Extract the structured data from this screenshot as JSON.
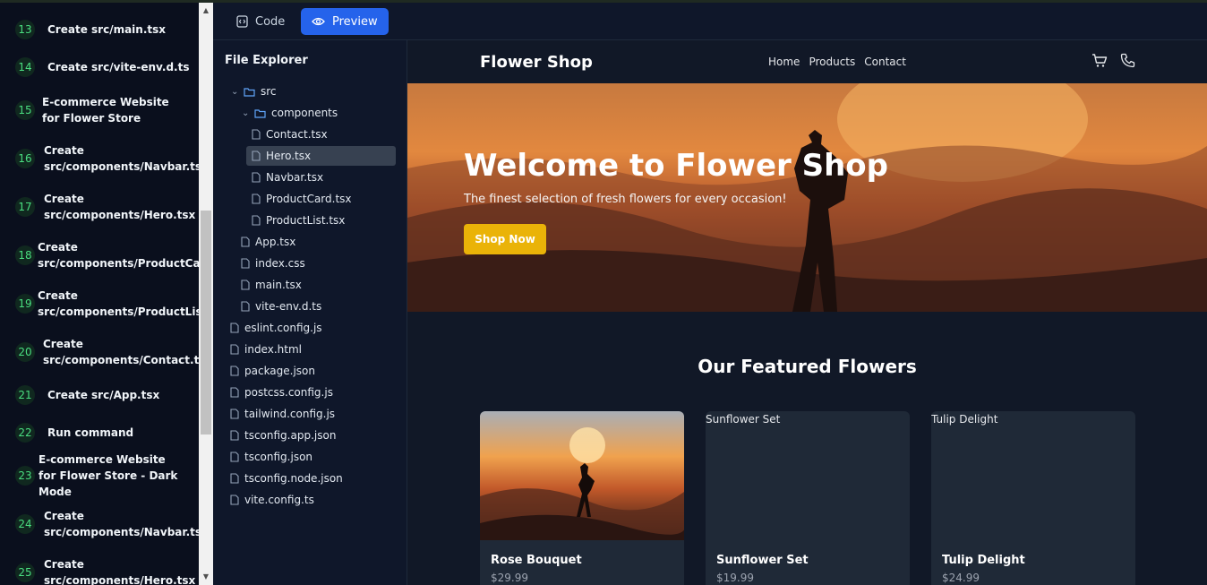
{
  "steps": [
    {
      "num": "13",
      "title": "Create src/main.tsx"
    },
    {
      "num": "14",
      "title": "Create src/vite-env.d.ts"
    },
    {
      "num": "15",
      "title": "E-commerce Website for Flower Store"
    },
    {
      "num": "16",
      "title": "Create src/components/Navbar.tsx"
    },
    {
      "num": "17",
      "title": "Create src/components/Hero.tsx"
    },
    {
      "num": "18",
      "title": "Create src/components/ProductCard.tsx"
    },
    {
      "num": "19",
      "title": "Create src/components/ProductList.tsx"
    },
    {
      "num": "20",
      "title": "Create src/components/Contact.tsx"
    },
    {
      "num": "21",
      "title": "Create src/App.tsx"
    },
    {
      "num": "22",
      "title": "Run command"
    },
    {
      "num": "23",
      "title": "E-commerce Website for Flower Store - Dark Mode"
    },
    {
      "num": "24",
      "title": "Create src/components/Navbar.tsx"
    },
    {
      "num": "25",
      "title": "Create src/components/Hero.tsx"
    }
  ],
  "toolbar": {
    "code_label": "Code",
    "preview_label": "Preview"
  },
  "explorer": {
    "title": "File Explorer",
    "items": [
      {
        "name": "src",
        "type": "folder",
        "open": true
      },
      {
        "name": "components",
        "type": "folder",
        "open": true
      },
      {
        "name": "Contact.tsx",
        "type": "file"
      },
      {
        "name": "Hero.tsx",
        "type": "file",
        "selected": true
      },
      {
        "name": "Navbar.tsx",
        "type": "file"
      },
      {
        "name": "ProductCard.tsx",
        "type": "file"
      },
      {
        "name": "ProductList.tsx",
        "type": "file"
      },
      {
        "name": "App.tsx",
        "type": "file"
      },
      {
        "name": "index.css",
        "type": "file"
      },
      {
        "name": "main.tsx",
        "type": "file"
      },
      {
        "name": "vite-env.d.ts",
        "type": "file"
      },
      {
        "name": "eslint.config.js",
        "type": "file"
      },
      {
        "name": "index.html",
        "type": "file"
      },
      {
        "name": "package.json",
        "type": "file"
      },
      {
        "name": "postcss.config.js",
        "type": "file"
      },
      {
        "name": "tailwind.config.js",
        "type": "file"
      },
      {
        "name": "tsconfig.app.json",
        "type": "file"
      },
      {
        "name": "tsconfig.json",
        "type": "file"
      },
      {
        "name": "tsconfig.node.json",
        "type": "file"
      },
      {
        "name": "vite.config.ts",
        "type": "file"
      }
    ]
  },
  "preview": {
    "brand": "Flower Shop",
    "nav_links": [
      "Home",
      "Products",
      "Contact"
    ],
    "icons": [
      "cart-icon",
      "phone-icon"
    ],
    "hero": {
      "title": "Welcome to Flower Shop",
      "subtitle": "The finest selection of fresh flowers for every occasion!",
      "button": "Shop Now"
    },
    "featured_title": "Our Featured Flowers",
    "products": [
      {
        "name": "Rose Bouquet",
        "price": "$29.99",
        "image_alt": ""
      },
      {
        "name": "Sunflower Set",
        "price": "$19.99",
        "image_alt": "Sunflower Set"
      },
      {
        "name": "Tulip Delight",
        "price": "$24.99",
        "image_alt": "Tulip Delight"
      }
    ]
  },
  "colors": {
    "accent": "#2563eb",
    "step_green": "#4ade80",
    "cta": "#eab308"
  }
}
